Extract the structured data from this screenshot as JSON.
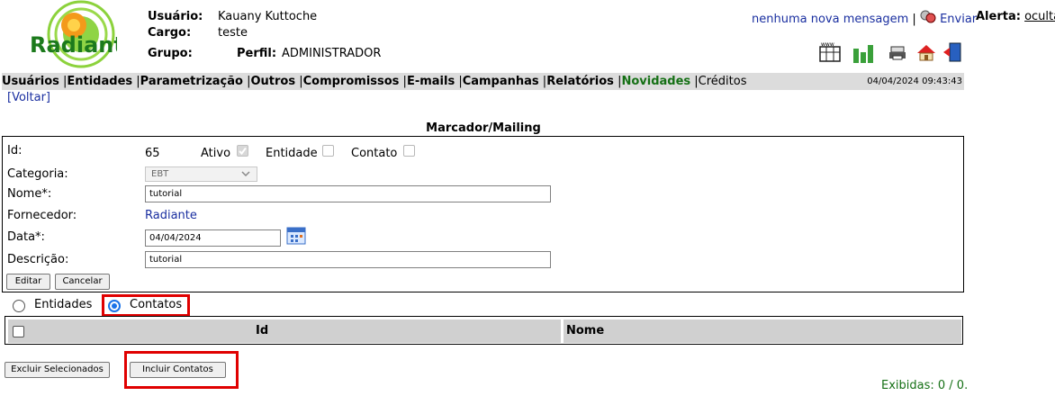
{
  "header": {
    "logo_text": "Radiante",
    "usuario_label": "Usuário:",
    "usuario_value": "Kauany Kuttoche",
    "cargo_label": "Cargo:",
    "cargo_value": "teste",
    "grupo_label": "Grupo:",
    "perfil_label": "Perfil:",
    "perfil_value": "ADMINISTRADOR",
    "messages_link": "nenhuma nova mensagem",
    "separator": "|",
    "enviar_label": "Enviar",
    "alerta_label": "Alerta:",
    "alerta_value": "oculta",
    "toolbar_icons": [
      "www-icon",
      "charts-icon",
      "printer-icon",
      "home-icon",
      "exit-door-icon"
    ]
  },
  "menu": {
    "items": [
      {
        "label": "Usuários",
        "style": "bold"
      },
      {
        "label": "Entidades",
        "style": "bold"
      },
      {
        "label": "Parametrização",
        "style": "bold"
      },
      {
        "label": "Outros",
        "style": "bold"
      },
      {
        "label": "Compromissos",
        "style": "bold"
      },
      {
        "label": "E-mails",
        "style": "bold"
      },
      {
        "label": "Campanhas",
        "style": "bold"
      },
      {
        "label": "Relatórios",
        "style": "bold"
      },
      {
        "label": "Novidades",
        "style": "green"
      },
      {
        "label": "Créditos",
        "style": "plain"
      }
    ],
    "datetime": "04/04/2024 09:43:43"
  },
  "voltar": "[Voltar]",
  "page_title": "Marcador/Mailing",
  "form": {
    "id_label": "Id:",
    "id_value": "65",
    "ativo_label": "Ativo",
    "ativo_checked": true,
    "entidade_label": "Entidade",
    "entidade_checked": false,
    "contato_label": "Contato",
    "contato_checked": false,
    "categoria_label": "Categoria:",
    "categoria_value": "EBT",
    "nome_label": "Nome*:",
    "nome_value": "tutorial",
    "fornecedor_label": "Fornecedor:",
    "fornecedor_value": "Radiante",
    "data_label": "Data*:",
    "data_value": "04/04/2024",
    "descricao_label": "Descrição:",
    "descricao_value": "tutorial",
    "editar_label": "Editar",
    "cancelar_label": "Cancelar"
  },
  "mode": {
    "entidades_label": "Entidades",
    "contatos_label": "Contatos",
    "selected": "Contatos"
  },
  "table": {
    "columns": [
      "",
      "Id",
      "Nome"
    ]
  },
  "actions": {
    "excluir_label": "Excluir Selecionados",
    "incluir_label": "Incluir Contatos"
  },
  "exibidas": "Exibidas: 0 / 0.",
  "colors": {
    "menu_bg": "#dcdcdc",
    "link_blue": "#1a2fa0",
    "green": "#157015",
    "highlight_red": "#e00000",
    "radio_blue": "#1a73e8"
  }
}
